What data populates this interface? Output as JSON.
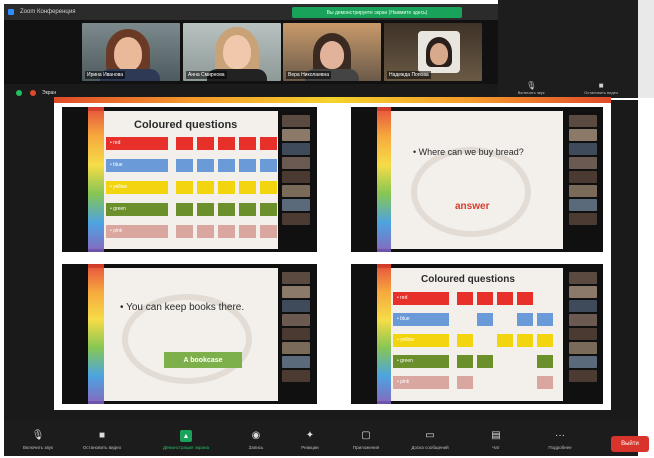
{
  "window": {
    "title": "Zoom Конференция"
  },
  "share_banner": {
    "text": "Вы демонстрируете экран (Нажмите здесь)"
  },
  "participants": [
    {
      "name": "Ирина Иванова"
    },
    {
      "name": "Анна Смирнова"
    },
    {
      "name": "Вера Николаевна"
    },
    {
      "name": "Надежда Попова"
    }
  ],
  "self_view": {
    "controls": [
      {
        "icon": "mic-icon",
        "label": "Включить звук"
      },
      {
        "icon": "video-icon",
        "label": "Остановить видео"
      }
    ]
  },
  "share_status": {
    "text": "Экран",
    "dot_colors": [
      "#21c063",
      "#e04a2a"
    ]
  },
  "slides": {
    "tl": {
      "title": "Coloured questions",
      "rows": [
        {
          "label": "red",
          "color": "#e8302b"
        },
        {
          "label": "blue",
          "color": "#6a9bd8"
        },
        {
          "label": "yellow",
          "color": "#f2d40f"
        },
        {
          "label": "green",
          "color": "#6b8f2a"
        },
        {
          "label": "pink",
          "color": "#d9a6a0"
        }
      ]
    },
    "tr": {
      "question": "• Where can we buy bread?",
      "answer": "answer"
    },
    "bl": {
      "question": "• You can keep books there.",
      "answer": "A bookcase"
    },
    "br": {
      "title": "Coloured questions",
      "rows": [
        {
          "label": "red",
          "color": "#e8302b"
        },
        {
          "label": "blue",
          "color": "#6a9bd8"
        },
        {
          "label": "yellow",
          "color": "#f2d40f"
        },
        {
          "label": "green",
          "color": "#6b8f2a"
        },
        {
          "label": "pink",
          "color": "#d9a6a0"
        }
      ]
    }
  },
  "toolbar": {
    "items": [
      {
        "icon": "mic-icon",
        "label": "Включить звук"
      },
      {
        "icon": "video-icon",
        "label": "Остановить видео"
      },
      {
        "icon": "share-screen-icon",
        "label": "Демонстрация экрана"
      },
      {
        "icon": "record-icon",
        "label": "Запись"
      },
      {
        "icon": "reactions-icon",
        "label": "Реакции"
      },
      {
        "icon": "apps-icon",
        "label": "Приложения"
      },
      {
        "icon": "whiteboard-icon",
        "label": "Доска сообщений"
      },
      {
        "icon": "chat-icon",
        "label": "Чат"
      },
      {
        "icon": "more-icon",
        "label": "Подробнее"
      }
    ],
    "leave_label": "Выйти"
  }
}
